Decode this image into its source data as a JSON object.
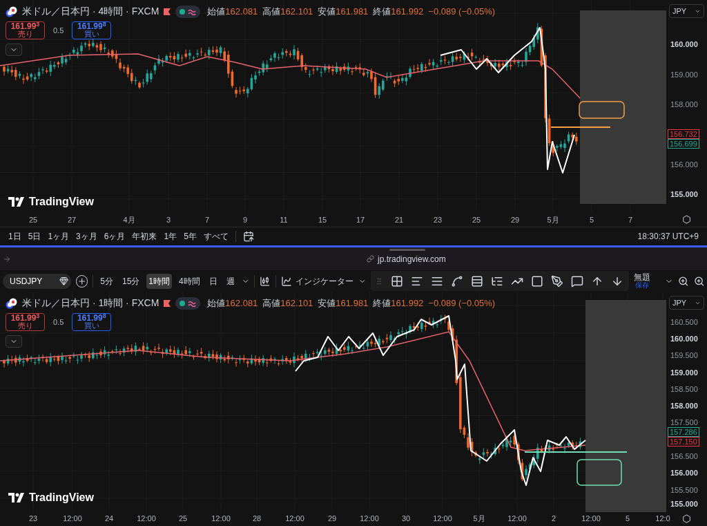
{
  "panes": [
    {
      "title": "米ドル／日本円 · 4時間 · FXCM",
      "ohlc": [
        {
          "label": "始値",
          "value": "162.081"
        },
        {
          "label": "高値",
          "value": "162.101"
        },
        {
          "label": "安値",
          "value": "161.981"
        },
        {
          "label": "終値",
          "value": "161.992"
        }
      ],
      "change": "−0.089 (−0.05%)",
      "sell": {
        "price": "161.99$^{3}$",
        "label": "売り"
      },
      "spread": "0.5",
      "buy": {
        "price": "161.99$^{8}$",
        "label": "買い"
      },
      "currency": "JPY",
      "logo_text": "TradingView",
      "price_labels": [
        {
          "text": "160.000",
          "major": true
        },
        {
          "text": "159.000",
          "major": false
        },
        {
          "text": "158.000",
          "major": false
        },
        {
          "text": "156.000",
          "major": false
        },
        {
          "text": "155.000",
          "major": true
        }
      ],
      "price_tags": [
        {
          "text": "156.732",
          "color": "#f23645"
        },
        {
          "text": "156.699",
          "color": "#22ab94"
        }
      ],
      "time_labels": [
        "25",
        "27",
        "4月",
        "3",
        "7",
        "9",
        "11",
        "15",
        "17",
        "21",
        "23",
        "25",
        "29",
        "5月",
        "5",
        "7"
      ]
    },
    {
      "title": "米ドル／日本円 · 1時間 · FXCM",
      "ohlc": [
        {
          "label": "始値",
          "value": "162.081"
        },
        {
          "label": "高値",
          "value": "162.101"
        },
        {
          "label": "安値",
          "value": "161.981"
        },
        {
          "label": "終値",
          "value": "161.992"
        }
      ],
      "change": "−0.089 (−0.05%)",
      "sell": {
        "price": "161.99$^{3}$",
        "label": "売り"
      },
      "spread": "0.5",
      "buy": {
        "price": "161.99$^{8}$",
        "label": "買い"
      },
      "currency": "JPY",
      "logo_text": "TradingView",
      "price_labels": [
        {
          "text": "160.500",
          "major": false
        },
        {
          "text": "160.000",
          "major": true
        },
        {
          "text": "159.500",
          "major": false
        },
        {
          "text": "159.000",
          "major": true
        },
        {
          "text": "158.500",
          "major": false
        },
        {
          "text": "158.000",
          "major": true
        },
        {
          "text": "157.500",
          "major": false
        },
        {
          "text": "156.500",
          "major": false
        },
        {
          "text": "156.000",
          "major": true
        },
        {
          "text": "155.500",
          "major": false
        },
        {
          "text": "155.000",
          "major": true
        }
      ],
      "price_tags": [
        {
          "text": "157.286",
          "color": "#22ab94"
        },
        {
          "text": "157.150",
          "color": "#f23645"
        }
      ],
      "time_labels": [
        "23",
        "12:00",
        "24",
        "12:00",
        "25",
        "12:00",
        "28",
        "12:00",
        "29",
        "12:00",
        "30",
        "12:00",
        "5月",
        "12:00",
        "2",
        "12:00",
        "5",
        "12:0"
      ]
    }
  ],
  "range_bar": {
    "ranges": [
      "1日",
      "5日",
      "1ヶ月",
      "3ヶ月",
      "6ヶ月",
      "年初来",
      "1年",
      "5年",
      "すべて"
    ],
    "clock": "18:30:37 UTC+9"
  },
  "browser": {
    "url": "jp.tradingview.com"
  },
  "toolbar": {
    "symbol": "USDJPY",
    "intervals": [
      {
        "label": "5分",
        "selected": false
      },
      {
        "label": "15分",
        "selected": false
      },
      {
        "label": "1時間",
        "selected": true
      },
      {
        "label": "4時間",
        "selected": false
      },
      {
        "label": "日",
        "selected": false
      },
      {
        "label": "週",
        "selected": false
      }
    ],
    "indicators": "インジケーター",
    "layout_name": "無題",
    "layout_status": "保存"
  }
}
